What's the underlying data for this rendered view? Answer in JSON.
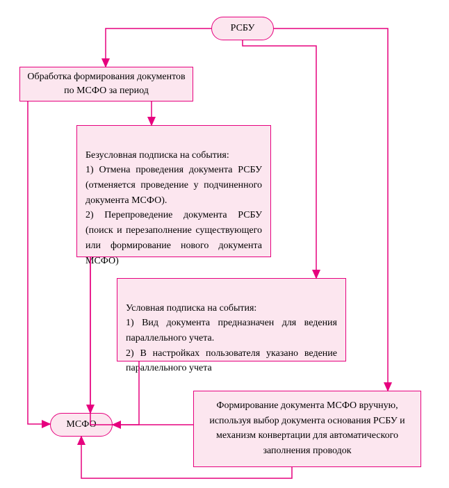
{
  "nodes": {
    "rsbu": {
      "label": "РСБУ"
    },
    "processing": {
      "label": "Обработка формирования документов по МСФО за период"
    },
    "unconditional": {
      "text": "Безусловная подписка на события:\n1) Отмена проведения документа РСБУ (отменяется проведение у подчиненного документа МСФО).\n2) Перепроведение документа РСБУ (поиск и перезаполнение существующего или формирование нового документа МСФО)"
    },
    "conditional": {
      "text": "Условная подписка на события:\n1) Вид документа предназначен для ведения параллельного учета.\n2) В настройках пользователя указано ведение параллельного учета"
    },
    "manual": {
      "text": "Формирование документа МСФО вручную, используя выбор документа основания РСБУ и механизм конвертации для автоматического заполнения проводок"
    },
    "msfo": {
      "label": "МСФО"
    }
  },
  "diagram_type": "flowchart",
  "colors": {
    "border": "#e6007e",
    "fill": "#fce6ef"
  }
}
